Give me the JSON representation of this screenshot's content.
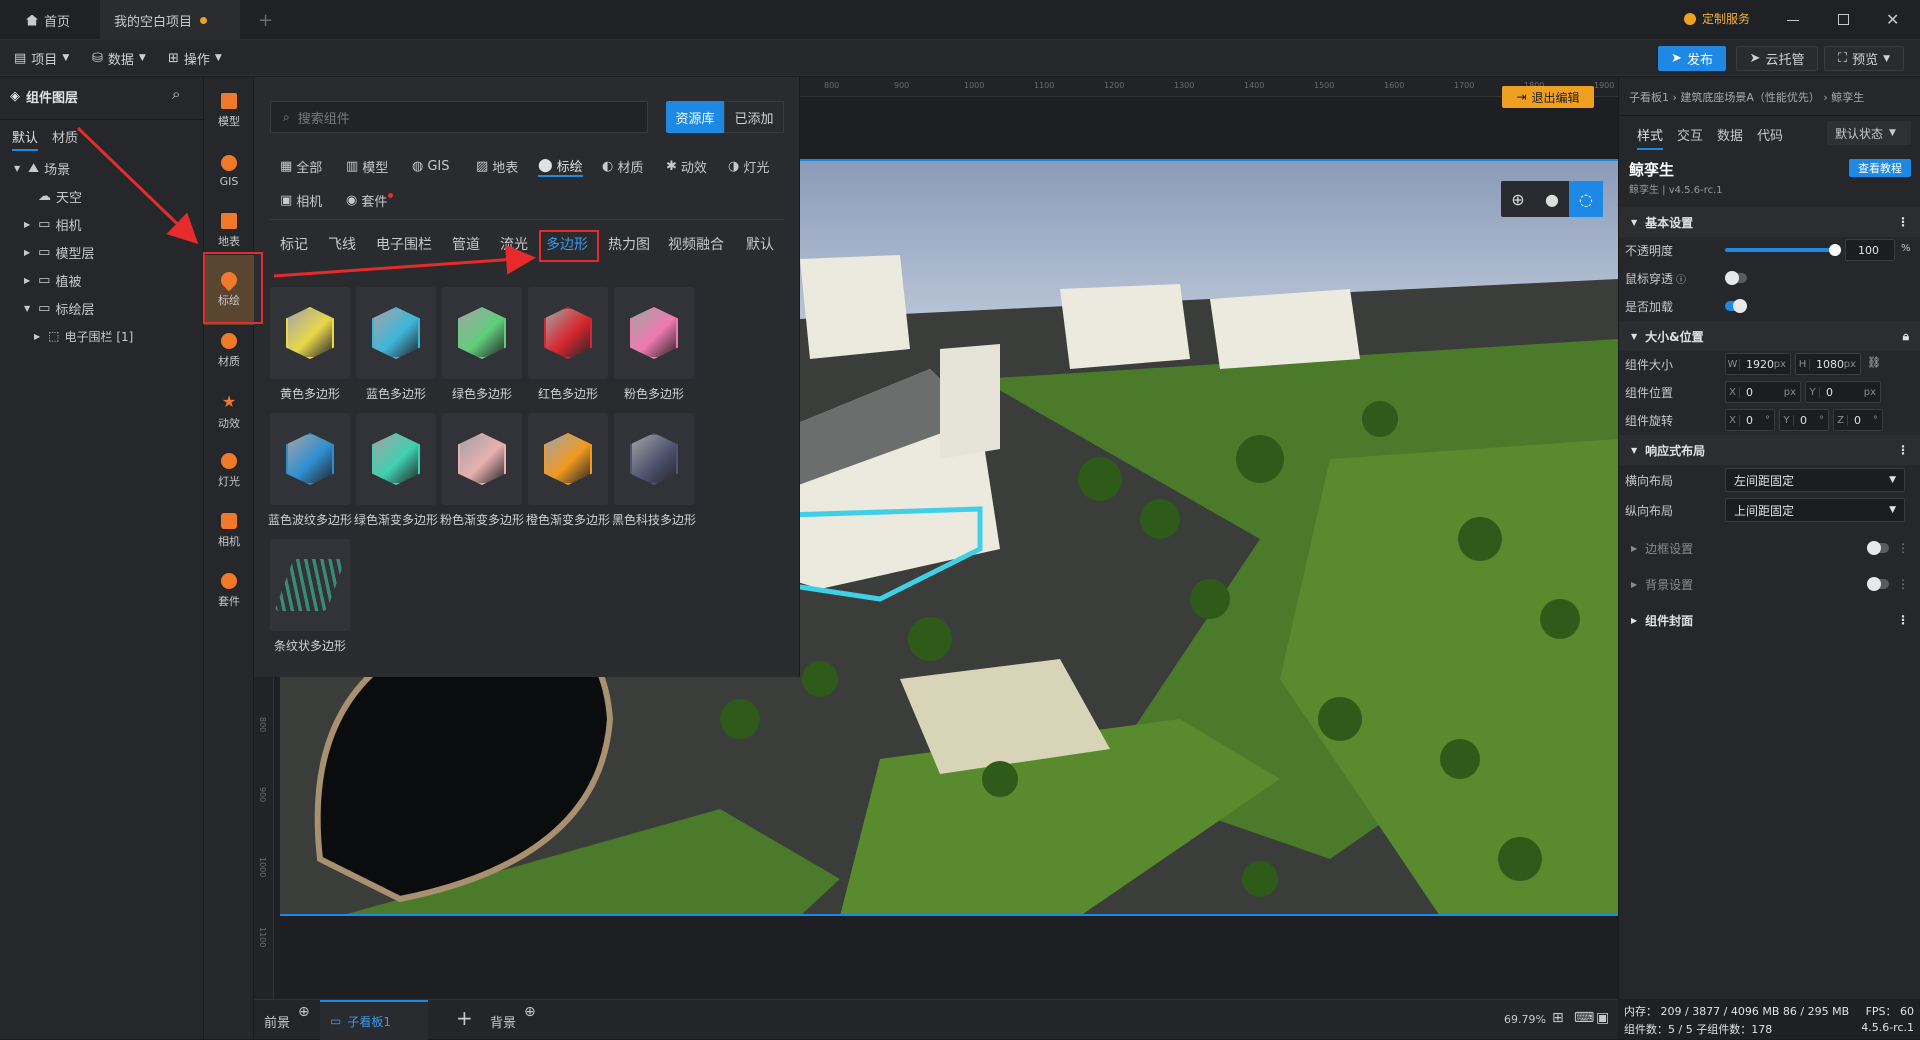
{
  "titlebar": {
    "home_tab": "首页",
    "project_tab": "我的空白项目",
    "custom_service": "定制服务",
    "add_tab": "+"
  },
  "toolbar": {
    "project": "项目",
    "data": "数据",
    "operation": "操作",
    "publish": "发布",
    "cloud_host": "云托管",
    "preview": "预览"
  },
  "layers": {
    "title": "组件图层",
    "tabs": [
      "默认",
      "材质"
    ],
    "tree": [
      {
        "label": "场景",
        "level": 0,
        "expanded": true
      },
      {
        "label": "天空",
        "level": 1
      },
      {
        "label": "相机",
        "level": 1
      },
      {
        "label": "模型层",
        "level": 1
      },
      {
        "label": "植被",
        "level": 1
      },
      {
        "label": "标绘层",
        "level": 1,
        "expanded": true
      },
      {
        "label": "电子围栏 [1]",
        "level": 2
      }
    ]
  },
  "rail": {
    "items": [
      "模型",
      "GIS",
      "地表",
      "标绘",
      "材质",
      "动效",
      "灯光",
      "相机",
      "套件"
    ],
    "active": "标绘"
  },
  "components": {
    "search_placeholder": "搜索组件",
    "tab_library": "资源库",
    "tab_added": "已添加",
    "categories": [
      "全部",
      "模型",
      "GIS",
      "地表",
      "标绘",
      "材质",
      "动效",
      "灯光",
      "相机",
      "套件"
    ],
    "active_category": "标绘",
    "subcategories": [
      "标记",
      "飞线",
      "电子围栏",
      "管道",
      "流光",
      "多边形",
      "热力图",
      "视频融合",
      "默认"
    ],
    "active_subcategory": "多边形",
    "items": [
      {
        "label": "黄色多边形",
        "color": "#e8d84a"
      },
      {
        "label": "蓝色多边形",
        "color": "#3fb6d8"
      },
      {
        "label": "绿色多边形",
        "color": "#5fcf7a"
      },
      {
        "label": "红色多边形",
        "color": "#d9262e"
      },
      {
        "label": "粉色多边形",
        "color": "#f07ab0"
      },
      {
        "label": "蓝色波纹多边形",
        "color": "#2e8fd0"
      },
      {
        "label": "绿色渐变多边形",
        "color": "#3ed0b0"
      },
      {
        "label": "粉色渐变多边形",
        "color": "#e8b0b0"
      },
      {
        "label": "橙色渐变多边形",
        "color": "#f09a20"
      },
      {
        "label": "黑色科技多边形",
        "color": "#505470"
      },
      {
        "label": "条纹状多边形",
        "color": "#3a8a7a"
      }
    ]
  },
  "canvas": {
    "exit_edit": "退出编辑",
    "ruler_top": [
      "800",
      "900",
      "1000",
      "1100",
      "1200",
      "1300",
      "1400",
      "1500",
      "1600",
      "1700",
      "1800",
      "1900"
    ],
    "ruler_left": [
      "800",
      "900",
      "1000",
      "1100"
    ]
  },
  "props": {
    "breadcrumb": "子看板1 › 建筑底座场景A（性能优先） › 鲸孪生",
    "tabs": [
      "样式",
      "交互",
      "数据",
      "代码"
    ],
    "state": "默认状态",
    "name": "鲸孪生",
    "version": "鲸孪生 | v4.5.6-rc.1",
    "tutorial": "查看教程",
    "basic": "基本设置",
    "opacity_label": "不透明度",
    "opacity_value": "100",
    "opacity_unit": "%",
    "opacity_level": 1.0,
    "mouse_through": "鼠标穿透",
    "mouse_through_on": false,
    "lazy_load": "是否加载",
    "lazy_load_on": true,
    "size_pos": "大小&位置",
    "size_label": "组件大小",
    "w": "1920",
    "h": "1080",
    "pos_label": "组件位置",
    "x": "0",
    "y": "0",
    "rot_label": "组件旋转",
    "rx": "0",
    "ry": "0",
    "rz": "0",
    "responsive": "响应式布局",
    "h_layout_label": "横向布局",
    "h_layout": "左间距固定",
    "v_layout_label": "纵向布局",
    "v_layout": "上间距固定",
    "border": "边框设置",
    "background": "背景设置",
    "cover": "组件封面",
    "px": "px",
    "deg": "°",
    "W": "W",
    "H": "H",
    "X": "X",
    "Y": "Y",
    "Z": "Z"
  },
  "bottom": {
    "foreground": "前景",
    "board": "子看板1",
    "background": "背景",
    "zoom": "69.79%"
  },
  "status": {
    "memory": "内存： 209 / 3877 / 4096 MB  86 / 295 MB",
    "fps": "FPS： 60",
    "components": "组件数：5 / 5   子组件数：178",
    "version": "4.5.6-rc.1"
  },
  "colors": {
    "accent": "#1e88e5",
    "brand_orange": "#f07a2a",
    "annotation_red": "#e52b2b"
  }
}
